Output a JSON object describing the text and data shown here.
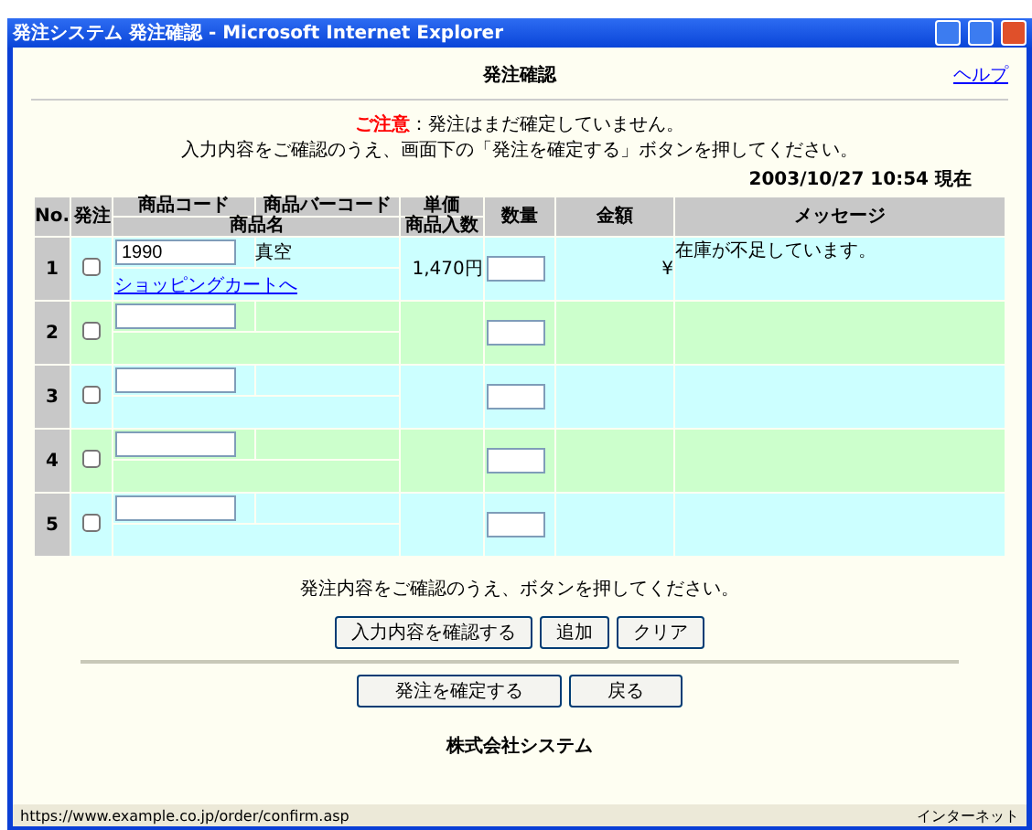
{
  "window": {
    "title": "発注システム 発注確認 - Microsoft Internet Explorer"
  },
  "help_link": "ヘルプ",
  "page_title": "発注確認",
  "notice": {
    "label": "ご注意",
    "line1": "：発注はまだ確定していません。",
    "line2": "入力内容をご確認のうえ、画面下の「発注を確定する」ボタンを押してください。"
  },
  "timestamp": "2003/10/27 10:54 現在",
  "table": {
    "columns": {
      "no": "No.",
      "order": "発注",
      "code": "商品コード",
      "barcode": "商品バーコード",
      "name": "商品名",
      "unit_price": "単価",
      "pack": "商品入数",
      "quantity": "数量",
      "amount": "金額",
      "message": "メッセージ"
    },
    "rows": [
      {
        "no": "1",
        "checked": false,
        "code": "1990",
        "barcode": "真空",
        "name": "ショッピングカートへ",
        "unit": "1,470円",
        "quantity": "",
        "amount": "¥",
        "message": "在庫が不足しています。"
      },
      {
        "no": "2",
        "checked": false,
        "code": "",
        "barcode": "",
        "name": "",
        "unit": "",
        "quantity": "",
        "amount": "",
        "message": ""
      },
      {
        "no": "3",
        "checked": false,
        "code": "",
        "barcode": "",
        "name": "",
        "unit": "",
        "quantity": "",
        "amount": "",
        "message": ""
      },
      {
        "no": "4",
        "checked": false,
        "code": "",
        "barcode": "",
        "name": "",
        "unit": "",
        "quantity": "",
        "amount": "",
        "message": ""
      },
      {
        "no": "5",
        "checked": false,
        "code": "",
        "barcode": "",
        "name": "",
        "unit": "",
        "quantity": "",
        "amount": "",
        "message": ""
      }
    ]
  },
  "note": "発注内容をご確認のうえ、ボタンを押してください。",
  "buttons": [
    "入力内容を確認する",
    "追加",
    "クリア"
  ],
  "buttons_bottom": [
    "発注を確定する",
    "戻る"
  ],
  "footer": "株式会社システム",
  "status_bar": {
    "url": "https://www.example.co.jp/order/confirm.asp",
    "zone": "インターネット"
  }
}
